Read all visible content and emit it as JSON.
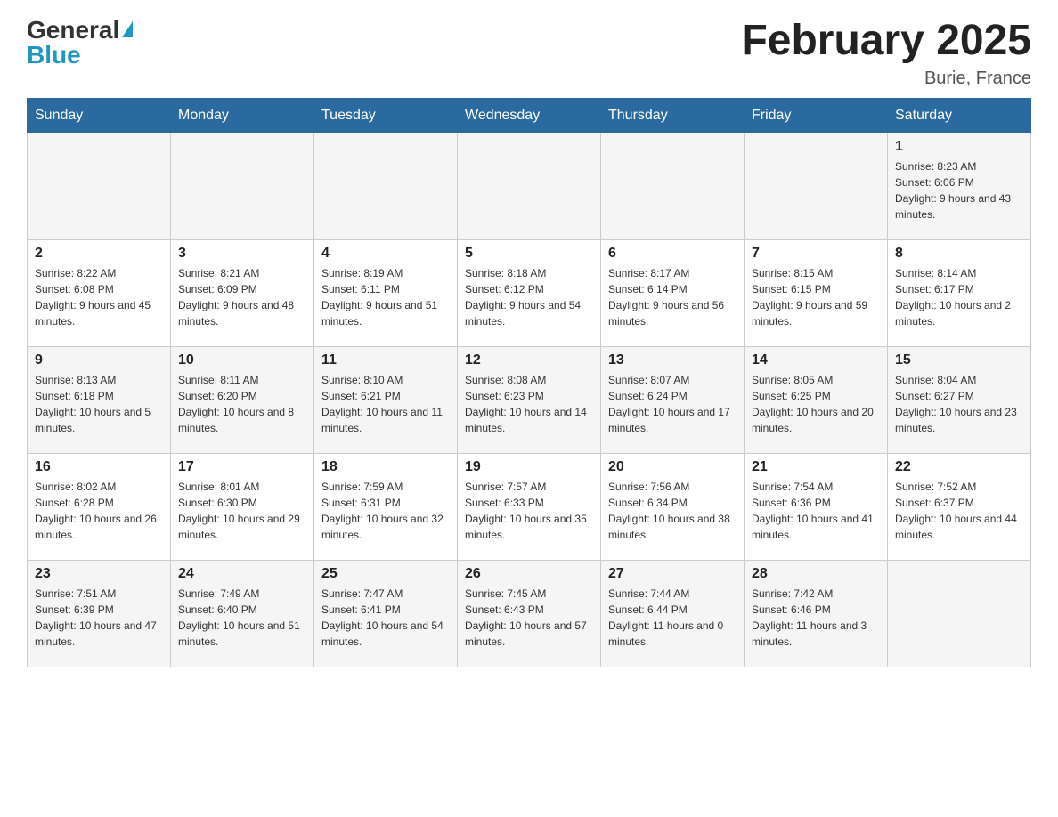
{
  "header": {
    "logo_general": "General",
    "logo_blue": "Blue",
    "title": "February 2025",
    "subtitle": "Burie, France"
  },
  "weekdays": [
    "Sunday",
    "Monday",
    "Tuesday",
    "Wednesday",
    "Thursday",
    "Friday",
    "Saturday"
  ],
  "weeks": [
    [
      {
        "day": "",
        "info": ""
      },
      {
        "day": "",
        "info": ""
      },
      {
        "day": "",
        "info": ""
      },
      {
        "day": "",
        "info": ""
      },
      {
        "day": "",
        "info": ""
      },
      {
        "day": "",
        "info": ""
      },
      {
        "day": "1",
        "info": "Sunrise: 8:23 AM\nSunset: 6:06 PM\nDaylight: 9 hours and 43 minutes."
      }
    ],
    [
      {
        "day": "2",
        "info": "Sunrise: 8:22 AM\nSunset: 6:08 PM\nDaylight: 9 hours and 45 minutes."
      },
      {
        "day": "3",
        "info": "Sunrise: 8:21 AM\nSunset: 6:09 PM\nDaylight: 9 hours and 48 minutes."
      },
      {
        "day": "4",
        "info": "Sunrise: 8:19 AM\nSunset: 6:11 PM\nDaylight: 9 hours and 51 minutes."
      },
      {
        "day": "5",
        "info": "Sunrise: 8:18 AM\nSunset: 6:12 PM\nDaylight: 9 hours and 54 minutes."
      },
      {
        "day": "6",
        "info": "Sunrise: 8:17 AM\nSunset: 6:14 PM\nDaylight: 9 hours and 56 minutes."
      },
      {
        "day": "7",
        "info": "Sunrise: 8:15 AM\nSunset: 6:15 PM\nDaylight: 9 hours and 59 minutes."
      },
      {
        "day": "8",
        "info": "Sunrise: 8:14 AM\nSunset: 6:17 PM\nDaylight: 10 hours and 2 minutes."
      }
    ],
    [
      {
        "day": "9",
        "info": "Sunrise: 8:13 AM\nSunset: 6:18 PM\nDaylight: 10 hours and 5 minutes."
      },
      {
        "day": "10",
        "info": "Sunrise: 8:11 AM\nSunset: 6:20 PM\nDaylight: 10 hours and 8 minutes."
      },
      {
        "day": "11",
        "info": "Sunrise: 8:10 AM\nSunset: 6:21 PM\nDaylight: 10 hours and 11 minutes."
      },
      {
        "day": "12",
        "info": "Sunrise: 8:08 AM\nSunset: 6:23 PM\nDaylight: 10 hours and 14 minutes."
      },
      {
        "day": "13",
        "info": "Sunrise: 8:07 AM\nSunset: 6:24 PM\nDaylight: 10 hours and 17 minutes."
      },
      {
        "day": "14",
        "info": "Sunrise: 8:05 AM\nSunset: 6:25 PM\nDaylight: 10 hours and 20 minutes."
      },
      {
        "day": "15",
        "info": "Sunrise: 8:04 AM\nSunset: 6:27 PM\nDaylight: 10 hours and 23 minutes."
      }
    ],
    [
      {
        "day": "16",
        "info": "Sunrise: 8:02 AM\nSunset: 6:28 PM\nDaylight: 10 hours and 26 minutes."
      },
      {
        "day": "17",
        "info": "Sunrise: 8:01 AM\nSunset: 6:30 PM\nDaylight: 10 hours and 29 minutes."
      },
      {
        "day": "18",
        "info": "Sunrise: 7:59 AM\nSunset: 6:31 PM\nDaylight: 10 hours and 32 minutes."
      },
      {
        "day": "19",
        "info": "Sunrise: 7:57 AM\nSunset: 6:33 PM\nDaylight: 10 hours and 35 minutes."
      },
      {
        "day": "20",
        "info": "Sunrise: 7:56 AM\nSunset: 6:34 PM\nDaylight: 10 hours and 38 minutes."
      },
      {
        "day": "21",
        "info": "Sunrise: 7:54 AM\nSunset: 6:36 PM\nDaylight: 10 hours and 41 minutes."
      },
      {
        "day": "22",
        "info": "Sunrise: 7:52 AM\nSunset: 6:37 PM\nDaylight: 10 hours and 44 minutes."
      }
    ],
    [
      {
        "day": "23",
        "info": "Sunrise: 7:51 AM\nSunset: 6:39 PM\nDaylight: 10 hours and 47 minutes."
      },
      {
        "day": "24",
        "info": "Sunrise: 7:49 AM\nSunset: 6:40 PM\nDaylight: 10 hours and 51 minutes."
      },
      {
        "day": "25",
        "info": "Sunrise: 7:47 AM\nSunset: 6:41 PM\nDaylight: 10 hours and 54 minutes."
      },
      {
        "day": "26",
        "info": "Sunrise: 7:45 AM\nSunset: 6:43 PM\nDaylight: 10 hours and 57 minutes."
      },
      {
        "day": "27",
        "info": "Sunrise: 7:44 AM\nSunset: 6:44 PM\nDaylight: 11 hours and 0 minutes."
      },
      {
        "day": "28",
        "info": "Sunrise: 7:42 AM\nSunset: 6:46 PM\nDaylight: 11 hours and 3 minutes."
      },
      {
        "day": "",
        "info": ""
      }
    ]
  ]
}
